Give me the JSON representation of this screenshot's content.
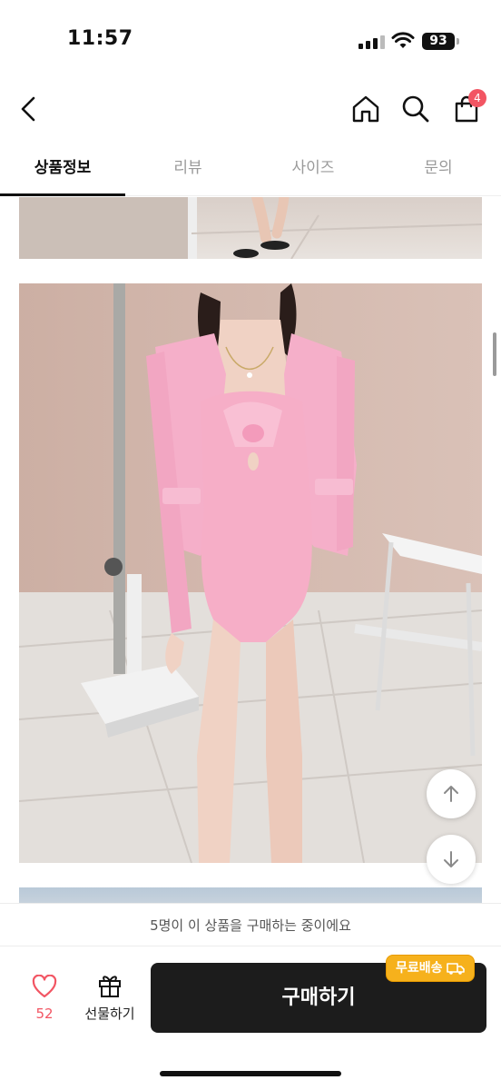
{
  "status_bar": {
    "time": "11:57",
    "battery": "93"
  },
  "header": {
    "back_icon": "chevron-left-icon",
    "home_icon": "home-icon",
    "search_icon": "search-icon",
    "cart_icon": "shopping-bag-icon",
    "cart_count": "4"
  },
  "tabs": [
    {
      "label": "상품정보",
      "active": true
    },
    {
      "label": "리뷰",
      "active": false
    },
    {
      "label": "사이즈",
      "active": false
    },
    {
      "label": "문의",
      "active": false
    }
  ],
  "float_buttons": {
    "up_icon": "arrow-up-icon",
    "down_icon": "arrow-down-icon"
  },
  "purchasing_notice": "5명이 이 상품을 구매하는 중이에요",
  "bottom_bar": {
    "like_icon": "heart-icon",
    "like_count": "52",
    "gift_icon": "gift-icon",
    "gift_label": "선물하기",
    "buy_label": "구매하기",
    "free_shipping_badge": "무료배송",
    "truck_icon": "truck-icon"
  },
  "colors": {
    "accent_red": "#f25563",
    "badge_yellow": "#f6b11c",
    "buy_button": "#1c1c1c"
  }
}
